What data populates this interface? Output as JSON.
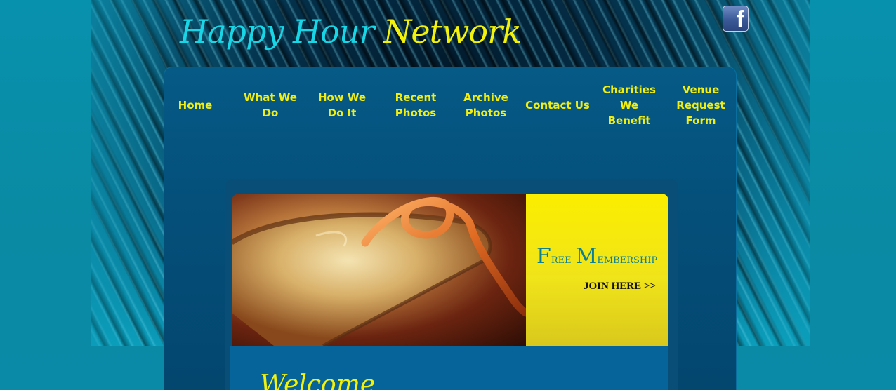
{
  "header": {
    "logo_part1": "Happy Hour",
    "logo_part2": "Network",
    "social_icon": "facebook-icon"
  },
  "nav": {
    "items": [
      {
        "label": "Home"
      },
      {
        "label": "What We Do"
      },
      {
        "label": "How We Do It"
      },
      {
        "label": "Recent Photos"
      },
      {
        "label": "Archive Photos"
      },
      {
        "label": "Contact Us"
      },
      {
        "label": "Charities We Benefit"
      },
      {
        "label": "Venue Request Form"
      }
    ]
  },
  "banner": {
    "image": "martini-cocktail-photo",
    "promo_title_first_cap": "F",
    "promo_title_first_rest": "ree ",
    "promo_title_second_cap": "M",
    "promo_title_second_rest": "embership",
    "join_label": "JOIN HERE  >>"
  },
  "content": {
    "welcome_heading": "Welcome"
  },
  "colors": {
    "accent_yellow": "#f2ee10",
    "logo_cyan": "#19d6e6",
    "panel_blue": "#04507b",
    "page_teal": "#0a8aa6"
  }
}
